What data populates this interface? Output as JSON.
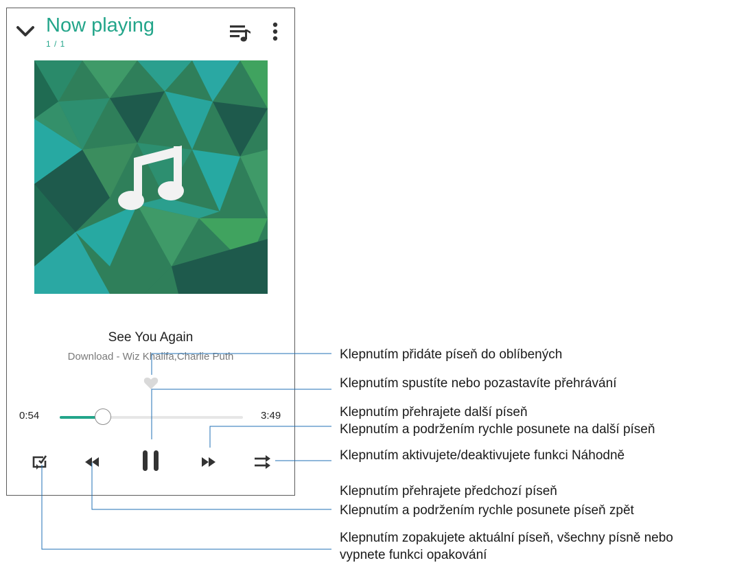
{
  "header": {
    "title": "Now playing",
    "track_index": "1 / 1",
    "collapse_icon": "chevron-down-icon",
    "queue_icon": "playlist-music-icon",
    "menu_icon": "more-vertical-icon"
  },
  "album_art": {
    "placeholder_icon": "music-note-icon"
  },
  "track": {
    "title": "See You Again",
    "subtitle": "Download - Wiz Khalifa,Charlie Puth"
  },
  "player": {
    "elapsed": "0:54",
    "duration": "3:49",
    "progress_fraction": 0.236
  },
  "controls": [
    {
      "name": "repeat-button",
      "icon": "repeat-icon"
    },
    {
      "name": "rewind-button",
      "icon": "rewind-icon"
    },
    {
      "name": "pause-button",
      "icon": "pause-icon"
    },
    {
      "name": "fast-forward-button",
      "icon": "fast-forward-icon"
    },
    {
      "name": "shuffle-button",
      "icon": "shuffle-icon"
    }
  ],
  "callouts": {
    "favorite": "Klepnutím přidáte píseň do oblíbených",
    "play_pause": "Klepnutím spustíte nebo pozastavíte přehrávání",
    "next_1": "Klepnutím přehrajete další píseň",
    "next_2": "Klepnutím a podržením rychle posunete na další píseň",
    "shuffle": "Klepnutím aktivujete/deaktivujete funkci Náhodně",
    "prev_1": "Klepnutím přehrajete předchozí píseň",
    "prev_2": "Klepnutím a podržením rychle posunete píseň zpět",
    "repeat_1": "Klepnutím zopakujete aktuální píseň, všechny písně nebo",
    "repeat_2": "vypnete funkci opakování"
  },
  "colors": {
    "accent": "#23a58a",
    "art_dark": "#1e5a4c",
    "art_mid": "#3a8a5c",
    "art_teal": "#27a9a2"
  }
}
